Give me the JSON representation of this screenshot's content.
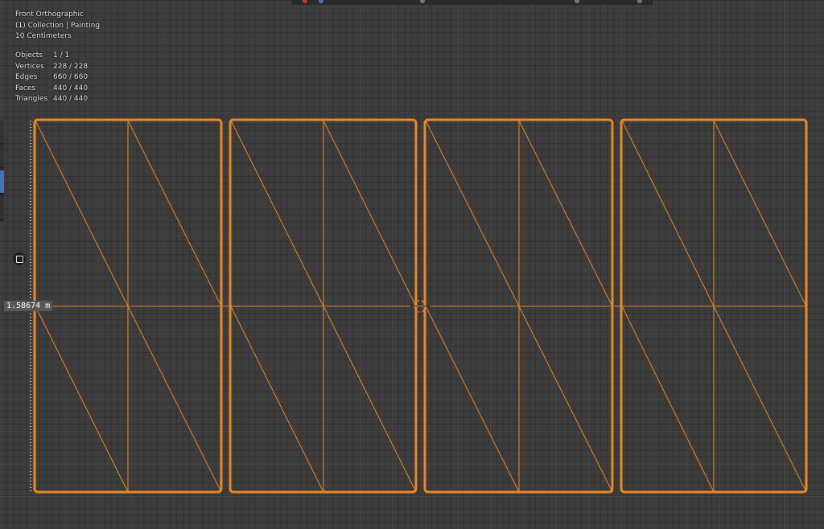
{
  "viewport": {
    "view_name": "Front Orthographic",
    "collection": "(1) Collection | Painting",
    "grid_scale": "10 Centimeters"
  },
  "stats": [
    {
      "label": "Objects",
      "value": "1 / 1"
    },
    {
      "label": "Vertices",
      "value": "228 / 228"
    },
    {
      "label": "Edges",
      "value": "660 / 660"
    },
    {
      "label": "Faces",
      "value": "440 / 440"
    },
    {
      "label": "Triangles",
      "value": "440 / 440"
    }
  ],
  "measurement": "1.58674 m",
  "selection_color": "#e8892a",
  "panel_count": 4
}
